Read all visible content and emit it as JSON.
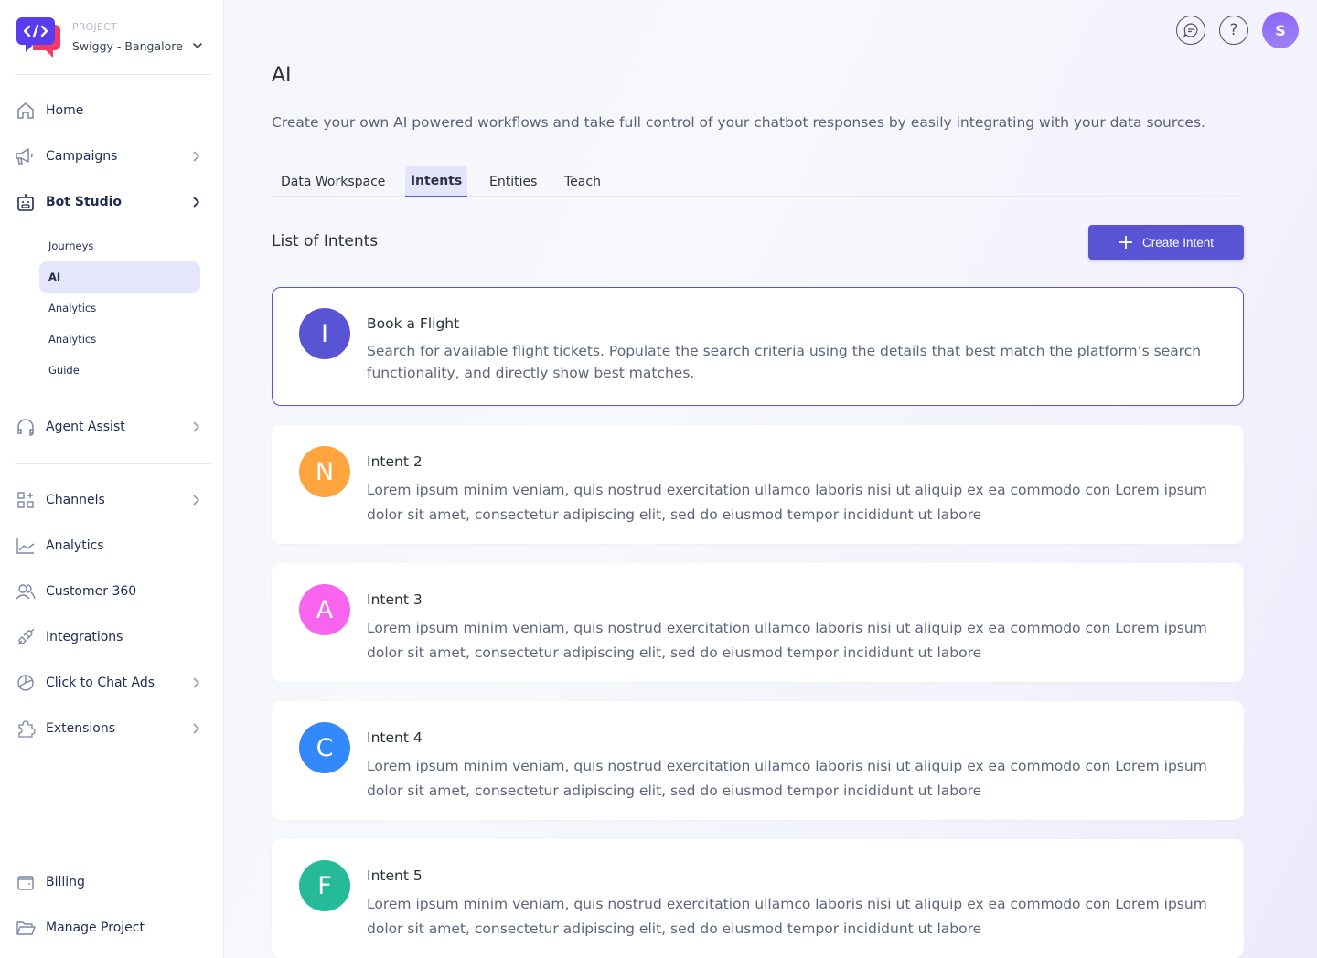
{
  "project": {
    "label": "PROJECT",
    "name": "Swiggy - Bangalore"
  },
  "sidebar": {
    "items": [
      {
        "label": "Home",
        "icon": "home-icon"
      },
      {
        "label": "Campaigns",
        "icon": "megaphone-icon"
      },
      {
        "label": "Bot Studio",
        "icon": "bot-icon"
      },
      {
        "label": "Agent Assist",
        "icon": "headset-icon"
      },
      {
        "label": "Channels",
        "icon": "grid-plus-icon"
      },
      {
        "label": "Analytics",
        "icon": "line-chart-icon"
      },
      {
        "label": "Customer 360",
        "icon": "users-icon"
      },
      {
        "label": "Integrations",
        "icon": "plug-icon"
      },
      {
        "label": "Click to Chat Ads",
        "icon": "pie-chart-icon"
      },
      {
        "label": "Extensions",
        "icon": "puzzle-icon"
      },
      {
        "label": "Billing",
        "icon": "wallet-icon"
      },
      {
        "label": "Manage Project",
        "icon": "folder-icon"
      }
    ],
    "bot_studio_sub": [
      {
        "label": "Journeys"
      },
      {
        "label": "AI"
      },
      {
        "label": "Analytics"
      },
      {
        "label": "Analytics"
      },
      {
        "label": "Guide"
      }
    ]
  },
  "header": {
    "avatar_initial": "S",
    "chat_icon": "chat-bubble-icon",
    "help_icon": "question-icon"
  },
  "page": {
    "title": "AI",
    "description": "Create your own AI powered workflows and take full control of your chatbot responses by easily integrating with your data sources.",
    "tabs": [
      {
        "label": "Data Workspace"
      },
      {
        "label": "Intents"
      },
      {
        "label": "Entities"
      },
      {
        "label": "Teach"
      }
    ],
    "active_tab": "Intents",
    "list_title": "List of Intents",
    "create_button": "Create Intent"
  },
  "intents": [
    {
      "initial": "I",
      "color": "#5854d4",
      "title": "Book a Flight",
      "description": "Search for available flight tickets. Populate the search criteria using the details that best match the platform’s search functionality, and directly show best matches."
    },
    {
      "initial": "N",
      "color": "#ffa53f",
      "title": "Intent 2",
      "description": "Lorem ipsum minim veniam, quis nostrud exercitation ullamco laboris nisi ut aliquip ex ea commodo con Lorem ipsum dolor sit amet, consectetur adipiscing elit, sed do eiusmod tempor incididunt ut labore"
    },
    {
      "initial": "A",
      "color": "#f964ef",
      "title": "Intent 3",
      "description": "Lorem ipsum minim veniam, quis nostrud exercitation ullamco laboris nisi ut aliquip ex ea commodo con Lorem ipsum dolor sit amet, consectetur adipiscing elit, sed do eiusmod tempor incididunt ut labore"
    },
    {
      "initial": "C",
      "color": "#3388fb",
      "title": "Intent 4",
      "description": "Lorem ipsum minim veniam, quis nostrud exercitation ullamco laboris nisi ut aliquip ex ea commodo con Lorem ipsum dolor sit amet, consectetur adipiscing elit, sed do eiusmod tempor incididunt ut labore"
    },
    {
      "initial": "F",
      "color": "#26bb98",
      "title": "Intent 5",
      "description": "Lorem ipsum minim veniam, quis nostrud exercitation ullamco laboris nisi ut aliquip ex ea commodo con Lorem ipsum dolor sit amet, consectetur adipiscing elit, sed do eiusmod tempor incididunt ut labore"
    }
  ]
}
